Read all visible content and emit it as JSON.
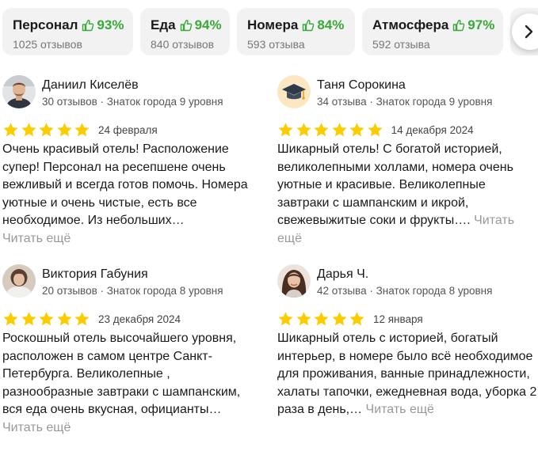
{
  "aspects": [
    {
      "name": "Персонал",
      "percent": "93%",
      "count": "1025 отзывов"
    },
    {
      "name": "Еда",
      "percent": "94%",
      "count": "840 отзывов"
    },
    {
      "name": "Номера",
      "percent": "84%",
      "count": "593 отзыва"
    },
    {
      "name": "Атмосфера",
      "percent": "97%",
      "count": "592 отзыва"
    }
  ],
  "colors": {
    "star": "#fbcc00",
    "positive": "#3aa83a",
    "chip_bg": "#f2f2f2",
    "read_more": "#999999"
  },
  "icons": {
    "thumb": "thumbs-up-icon",
    "next": "chevron-right-icon",
    "star": "star-icon"
  },
  "reviews": [
    {
      "name": "Даниил Киселёв",
      "meta": "30 отзывов · Знаток города 9 уровня",
      "rating": 5,
      "date": "24 февраля",
      "text": "Очень красивый отель! Расположение супер! Персонал на ресепшене очень вежливый и всегда готов помочь. Номера уютные и очень чистые, есть все необходимое. Из небольших…",
      "read_more": "Читать ещё"
    },
    {
      "name": "Таня Сорокина",
      "meta": "34 отзыва · Знаток города 9 уровня",
      "rating": 5,
      "date": "14 декабря 2024",
      "text": "Шикарный отель! С богатой историей, великолепными холлами, номера очень уютные и красивые. Великолепные завтраки с шампанским и икрой, свежевыжитые соки и фрукты….",
      "read_more": "Читать ещё"
    },
    {
      "name": "Виктория Габуния",
      "meta": "20 отзывов · Знаток города 8 уровня",
      "rating": 5,
      "date": "23 декабря 2024",
      "text": "Роскошный отель высочайшего уровня, расположен в самом центре Санкт-Петербурга. Великолепные , разнообразные завтраки с шампанским, вся еда очень вкусная, официанты…",
      "read_more": "Читать ещё"
    },
    {
      "name": "Дарья Ч.",
      "meta": "42 отзыва · Знаток города 8 уровня",
      "rating": 5,
      "date": "12 января",
      "text": "Шикарный отель с историей, богатый интерьер, в номере было всё необходимое для проживания, ванные принадлежности, халаты тапочки, ежедневная вода, уборка 2 раза в день,…",
      "read_more": "Читать ещё"
    }
  ]
}
